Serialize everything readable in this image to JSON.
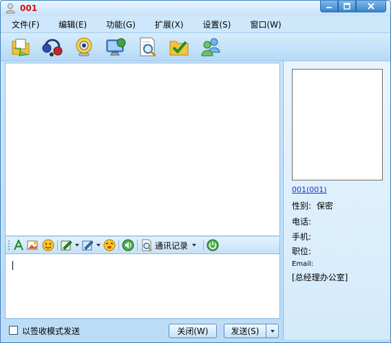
{
  "window": {
    "title": "001",
    "icon": "user-icon",
    "buttons": [
      "minimize-icon",
      "maximize-icon",
      "close-icon"
    ]
  },
  "menubar": {
    "items": [
      {
        "label": "文件(F)"
      },
      {
        "label": "编辑(E)"
      },
      {
        "label": "功能(G)"
      },
      {
        "label": "扩展(X)"
      },
      {
        "label": "设置(S)"
      },
      {
        "label": "窗口(W)"
      }
    ]
  },
  "toolbar": {
    "icons": [
      "send-file-icon",
      "voice-chat-icon",
      "video-chat-icon",
      "remote-desktop-icon",
      "search-document-icon",
      "shared-folder-icon",
      "group-chat-icon"
    ]
  },
  "input_toolbar": {
    "icons": [
      "font-icon",
      "image-icon",
      "emoticon-icon",
      "handwrite-icon",
      "screenshot-icon",
      "shake-icon",
      "sound-icon",
      "history-icon",
      "power-icon"
    ],
    "history_label": "通讯记录"
  },
  "bottom": {
    "checkbox_label": "以签收模式发送",
    "checkbox_checked": false,
    "close_button": "关闭(W)",
    "send_button": "发送(S)"
  },
  "contact": {
    "link": "001(001)",
    "gender_label": "性别:",
    "gender_value": "保密",
    "phone_label": "电话:",
    "mobile_label": "手机:",
    "position_label": "职位:",
    "email_label": "Email:",
    "department": "[总经理办公室]"
  },
  "colors": {
    "title_text": "#d4101a",
    "accent": "#3b84cc",
    "link": "#1a33c8"
  }
}
